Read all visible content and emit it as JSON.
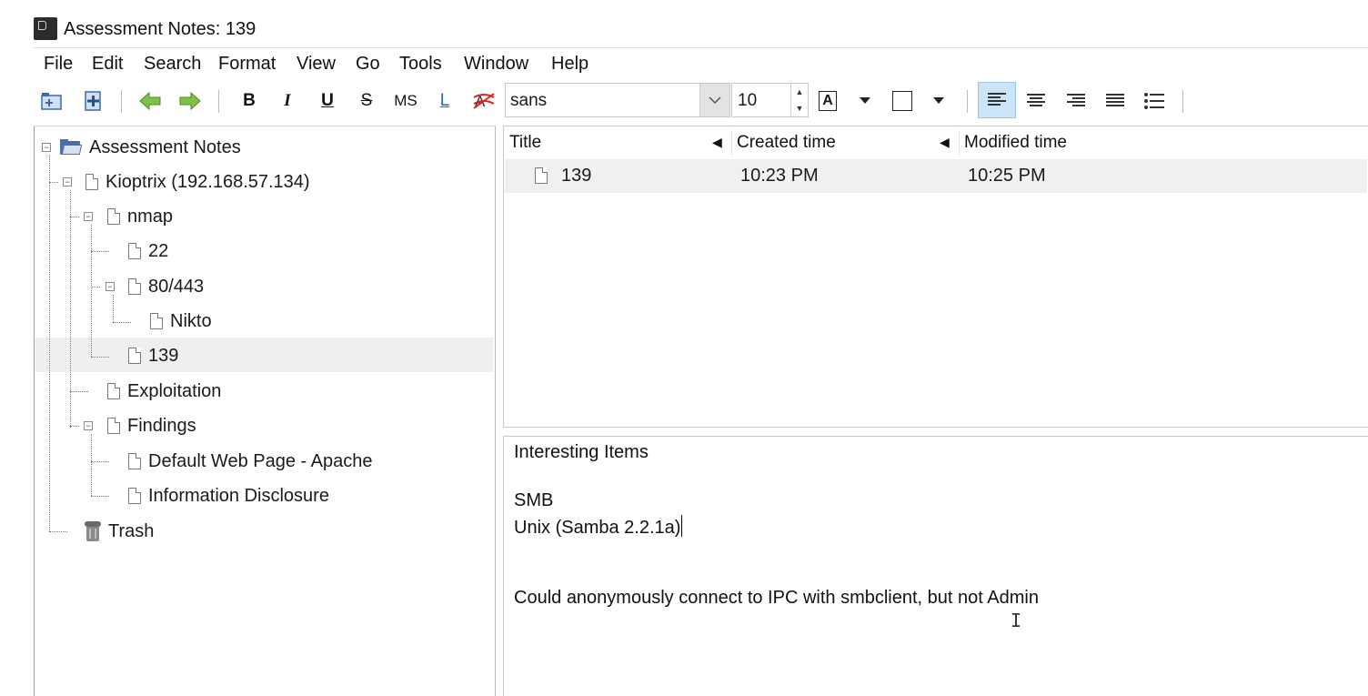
{
  "window": {
    "title": "Assessment Notes: 139"
  },
  "menubar": [
    "File",
    "Edit",
    "Search",
    "Format",
    "View",
    "Go",
    "Tools",
    "Window",
    "Help"
  ],
  "toolbar": {
    "bold": "B",
    "italic": "I",
    "underline": "U",
    "strike": "S",
    "monospace": "MS",
    "link": "L",
    "font_family": "sans",
    "font_size": "10",
    "text_color_glyph": "A"
  },
  "tree": {
    "root": "Assessment Notes",
    "items": [
      {
        "label": "Kioptrix (192.168.57.134)"
      },
      {
        "label": "nmap"
      },
      {
        "label": "22"
      },
      {
        "label": "80/443"
      },
      {
        "label": "Nikto"
      },
      {
        "label": "139"
      },
      {
        "label": "Exploitation"
      },
      {
        "label": "Findings"
      },
      {
        "label": "Default Web Page - Apache"
      },
      {
        "label": "Information Disclosure"
      },
      {
        "label": "Trash"
      }
    ]
  },
  "list": {
    "columns": [
      "Title",
      "Created time",
      "Modified time"
    ],
    "rows": [
      {
        "title": "139",
        "created": "10:23 PM",
        "modified": "10:25 PM"
      }
    ]
  },
  "editor": {
    "lines": [
      "Interesting Items",
      "SMB",
      "Unix (Samba 2.2.1a)",
      "Could anonymously connect to IPC with smbclient, but not Admin"
    ]
  }
}
